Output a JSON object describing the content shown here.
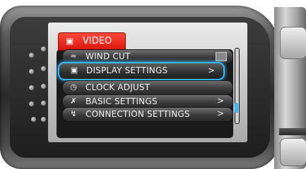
{
  "menu": {
    "tab_label": "VIDEO",
    "tab_icon": "video-camera-icon",
    "items": [
      {
        "label": "WIND CUT",
        "icon": "wind-icon",
        "trailing": "toggle-graphic"
      },
      {
        "label": "DISPLAY SETTINGS",
        "icon": "display-icon",
        "trailing": ">",
        "selected": true
      },
      {
        "label": "CLOCK ADJUST",
        "icon": "clock-icon",
        "trailing": ""
      },
      {
        "label": "BASIC SETTINGS",
        "icon": "tools-icon",
        "trailing": ">"
      },
      {
        "label": "CONNECTION SETTINGS",
        "icon": "connection-icon",
        "trailing": ">"
      }
    ]
  },
  "colors": {
    "tab_red": "#e21a12",
    "highlight_blue": "#35b8ff",
    "row_dark": "#2b2b2b"
  }
}
